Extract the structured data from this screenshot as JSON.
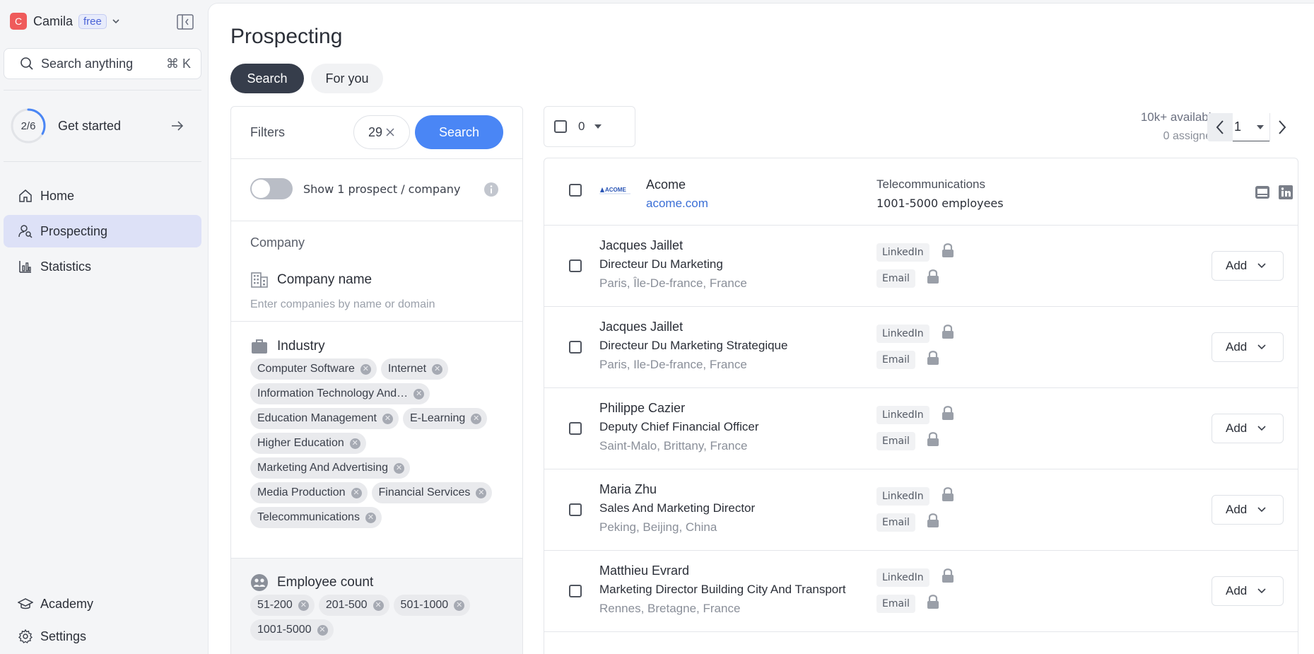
{
  "workspace": {
    "initial": "C",
    "name": "Camila",
    "plan": "free"
  },
  "search": {
    "placeholder": "Search anything",
    "shortcut": "⌘ K"
  },
  "get_started": {
    "progress": "2/6",
    "progress_fraction": 0.33,
    "label": "Get started"
  },
  "nav": {
    "items": [
      {
        "label": "Home",
        "icon": "home-icon"
      },
      {
        "label": "Prospecting",
        "icon": "prospecting-icon",
        "active": true
      },
      {
        "label": "Statistics",
        "icon": "statistics-icon"
      }
    ],
    "bottom": [
      {
        "label": "Academy",
        "icon": "academy-icon"
      },
      {
        "label": "Settings",
        "icon": "gear-icon"
      }
    ]
  },
  "page": {
    "title": "Prospecting",
    "tabs": [
      "Search",
      "For you"
    ]
  },
  "filters": {
    "label": "Filters",
    "count": "29",
    "search_label": "Search",
    "toggle_label": "Show 1 prospect / company",
    "section_company": "Company",
    "company_name": {
      "title": "Company name",
      "placeholder": "Enter companies by name or domain"
    },
    "industry": {
      "title": "Industry",
      "chips": [
        "Computer Software",
        "Internet",
        "Information Technology And…",
        "Education Management",
        "E-Learning",
        "Higher Education",
        "Marketing And Advertising",
        "Media Production",
        "Financial Services",
        "Telecommunications"
      ]
    },
    "employee_count": {
      "title": "Employee count",
      "chips": [
        "51-200",
        "201-500",
        "501-1000",
        "1001-5000"
      ]
    }
  },
  "results": {
    "selected_count": "0",
    "available": "10k+ available",
    "assigned": "0 assigned",
    "page": "1",
    "company": {
      "logo_text": "ACOME",
      "name": "Acome",
      "domain": "acome.com",
      "industry": "Telecommunications",
      "employees": "1001-5000 employees"
    },
    "tag_linkedin": "LinkedIn",
    "tag_email": "Email",
    "add_label": "Add",
    "prospects": [
      {
        "name": "Jacques Jaillet",
        "title": "Directeur Du Marketing",
        "location": "Paris, Île-De-france, France"
      },
      {
        "name": "Jacques Jaillet",
        "title": "Directeur Du Marketing Strategique",
        "location": "Paris, Ile-De-france, France"
      },
      {
        "name": "Philippe Cazier",
        "title": "Deputy Chief Financial Officer",
        "location": "Saint-Malo, Brittany, France"
      },
      {
        "name": "Maria Zhu",
        "title": "Sales And Marketing Director",
        "location": "Peking, Beijing, China"
      },
      {
        "name": "Matthieu Evrard",
        "title": "Marketing Director Building City And Transport",
        "location": "Rennes, Bretagne, France"
      }
    ]
  },
  "colors": {
    "accent": "#4a86f5",
    "active_nav": "#dde1f7",
    "link": "#3b6fd6",
    "avatar": "#ef5b5b"
  }
}
